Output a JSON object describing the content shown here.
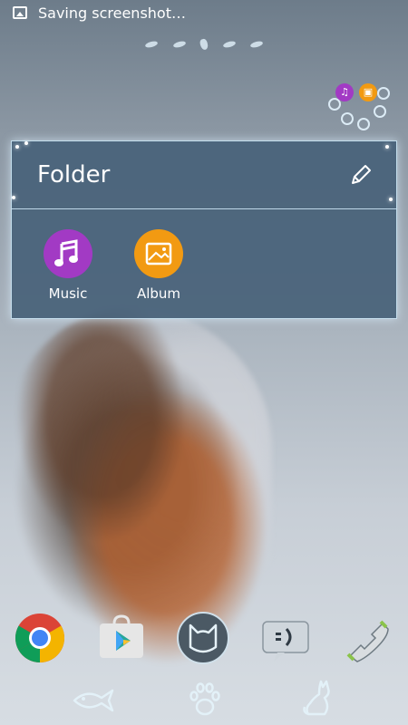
{
  "status_bar": {
    "notification_text": "Saving screenshot…",
    "icon": "image-icon"
  },
  "home": {
    "page_count": 5,
    "active_page": 3
  },
  "folder": {
    "title": "Folder",
    "apps": [
      {
        "label": "Music",
        "icon": "music-note-icon",
        "color": "#a23ac4"
      },
      {
        "label": "Album",
        "icon": "album-icon",
        "color": "#f29a12"
      }
    ]
  },
  "dock": [
    {
      "name": "chrome",
      "icon": "chrome-icon"
    },
    {
      "name": "play-store",
      "icon": "play-store-icon"
    },
    {
      "name": "app-drawer",
      "icon": "cat-face-icon"
    },
    {
      "name": "messaging",
      "icon": "message-icon"
    },
    {
      "name": "phone",
      "icon": "phone-icon"
    }
  ],
  "navigation": [
    {
      "name": "back",
      "icon": "fish-icon"
    },
    {
      "name": "home",
      "icon": "paw-icon"
    },
    {
      "name": "recents",
      "icon": "cat-silhouette-icon"
    }
  ],
  "colors": {
    "folder_background": "#48627a",
    "folder_border": "#d2ebfa",
    "music": "#a23ac4",
    "album": "#f29a12"
  }
}
